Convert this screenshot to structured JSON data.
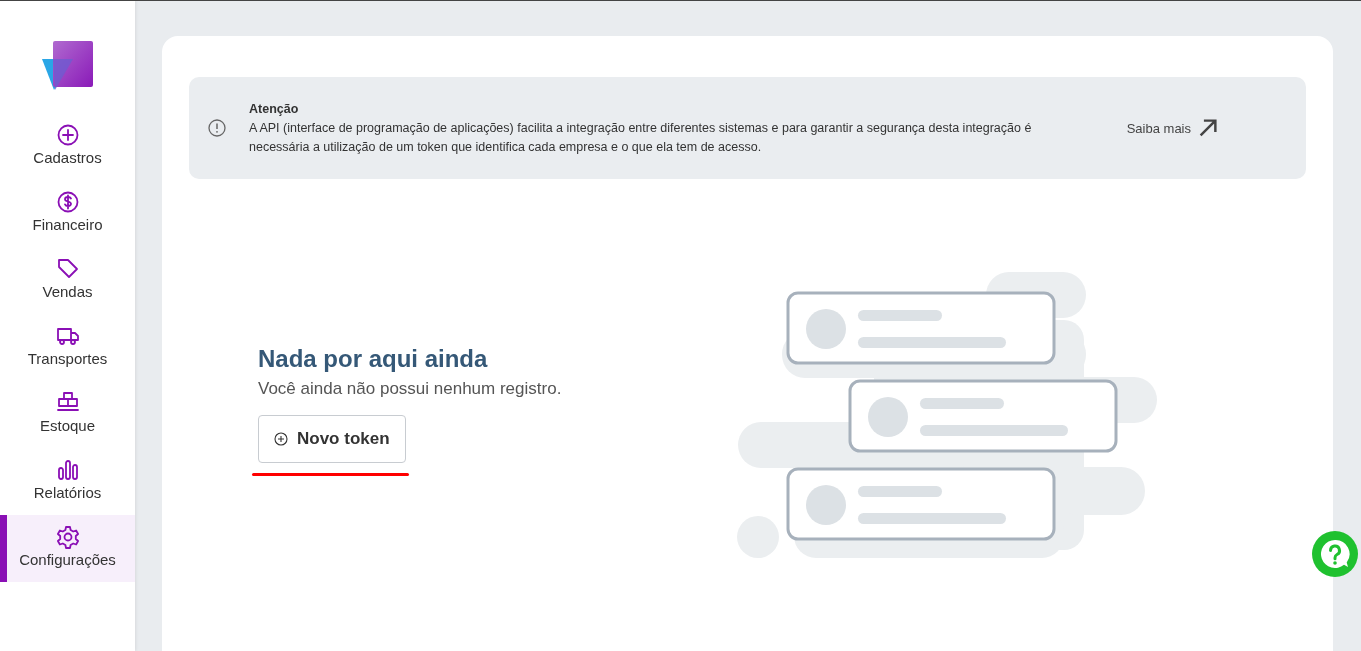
{
  "sidebar": {
    "items": [
      {
        "label": "Cadastros",
        "selected": false
      },
      {
        "label": "Financeiro",
        "selected": false
      },
      {
        "label": "Vendas",
        "selected": false
      },
      {
        "label": "Transportes",
        "selected": false
      },
      {
        "label": "Estoque",
        "selected": false
      },
      {
        "label": "Relatórios",
        "selected": false
      },
      {
        "label": "Configurações",
        "selected": true
      }
    ]
  },
  "alert": {
    "title": "Atenção",
    "text": "A API (interface de programação de aplicações) facilita a integração entre diferentes sistemas e para garantir a segurança desta integração é necessária a utilização de um token que identifica cada empresa e o que ela tem de acesso.",
    "link": "Saiba mais"
  },
  "empty_state": {
    "title": "Nada por aqui ainda",
    "subtitle": "Você ainda não possui nenhum registro.",
    "button": "Novo token"
  }
}
